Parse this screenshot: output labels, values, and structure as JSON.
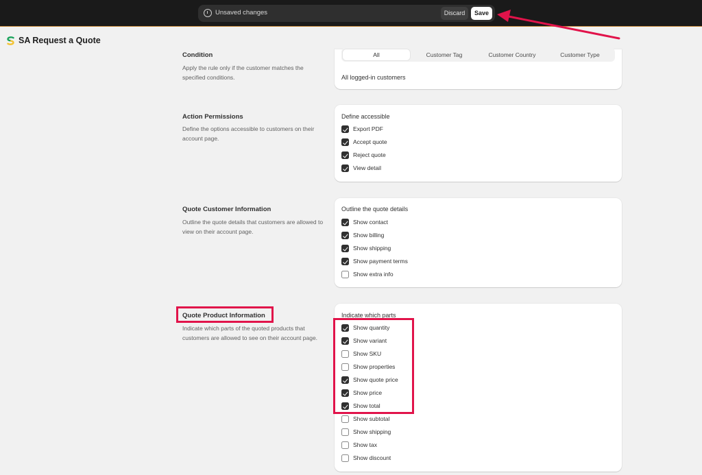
{
  "savebar": {
    "message": "Unsaved changes",
    "discard_label": "Discard",
    "save_label": "Save"
  },
  "app": {
    "title": "SA Request a Quote"
  },
  "sections": {
    "condition": {
      "title": "Condition",
      "description": "Apply the rule only if the customer matches the specified conditions.",
      "tabs": [
        "All",
        "Customer Tag",
        "Customer Country",
        "Customer Type"
      ],
      "selected_tab": "All",
      "body_text": "All logged-in customers"
    },
    "action_permissions": {
      "title": "Action Permissions",
      "description": "Define the options accessible to customers on their account page.",
      "card_label": "Define accessible",
      "options": [
        {
          "label": "Export PDF",
          "checked": true
        },
        {
          "label": "Accept quote",
          "checked": true
        },
        {
          "label": "Reject quote",
          "checked": true
        },
        {
          "label": "View detail",
          "checked": true
        }
      ]
    },
    "customer_info": {
      "title": "Quote Customer Information",
      "description": "Outline the quote details that customers are allowed to view on their account page.",
      "card_label": "Outline the quote details",
      "options": [
        {
          "label": "Show contact",
          "checked": true
        },
        {
          "label": "Show billing",
          "checked": true
        },
        {
          "label": "Show shipping",
          "checked": true
        },
        {
          "label": "Show payment terms",
          "checked": true
        },
        {
          "label": "Show extra info",
          "checked": false
        }
      ]
    },
    "product_info": {
      "title": "Quote Product Information",
      "description": "Indicate which parts of the quoted products that customers are allowed to see on their account page.",
      "card_label": "Indicate which parts",
      "options": [
        {
          "label": "Show quantity",
          "checked": true
        },
        {
          "label": "Show variant",
          "checked": true
        },
        {
          "label": "Show SKU",
          "checked": false
        },
        {
          "label": "Show properties",
          "checked": false
        },
        {
          "label": "Show quote price",
          "checked": true
        },
        {
          "label": "Show price",
          "checked": true
        },
        {
          "label": "Show total",
          "checked": true
        },
        {
          "label": "Show subtotal",
          "checked": false
        },
        {
          "label": "Show shipping",
          "checked": false
        },
        {
          "label": "Show tax",
          "checked": false
        },
        {
          "label": "Show discount",
          "checked": false
        }
      ]
    }
  },
  "colors": {
    "highlight": "#e1134a",
    "topbar": "#1a1a1a",
    "checkbox_checked": "#303030"
  },
  "icons": {
    "savebar": "info-icon",
    "app": "sa-logo-icon",
    "annotation": "red-arrow"
  }
}
